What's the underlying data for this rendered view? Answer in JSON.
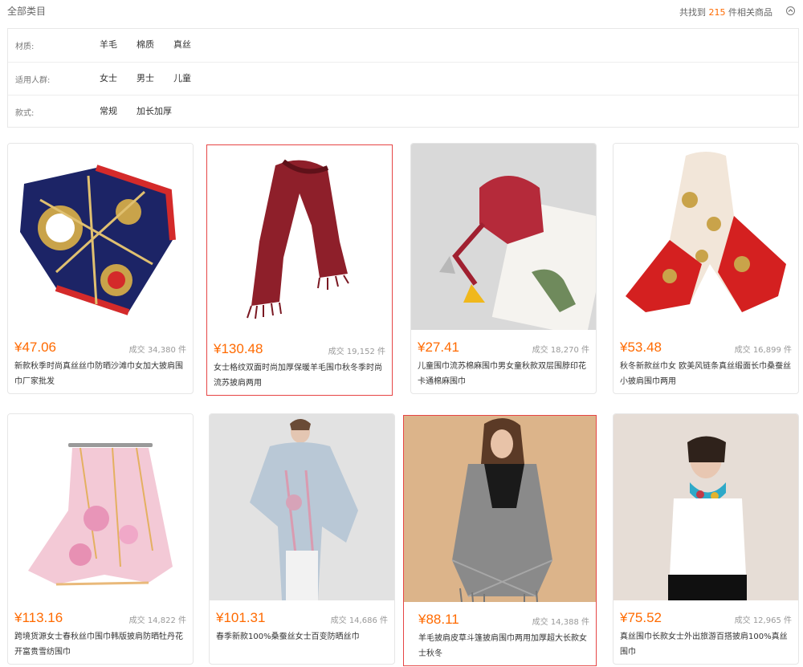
{
  "header": {
    "all_categories": "全部类目",
    "found_prefix": "共找到",
    "found_count": "215",
    "found_suffix": "件相关商品"
  },
  "filters": [
    {
      "label": "材质:",
      "options": [
        "羊毛",
        "棉质",
        "真丝"
      ]
    },
    {
      "label": "适用人群:",
      "options": [
        "女士",
        "男士",
        "儿童"
      ]
    },
    {
      "label": "款式:",
      "options": [
        "常规",
        "加长加厚"
      ]
    }
  ],
  "products": [
    {
      "price": "¥47.06",
      "sales": "成交 34,380 件",
      "title": "新款秋季时尚真丝丝巾防晒沙滩巾女加大披肩围巾厂家批发"
    },
    {
      "price": "¥130.48",
      "sales": "成交 19,152 件",
      "title": "女士格纹双面时尚加厚保暖羊毛围巾秋冬季时尚流苏披肩两用"
    },
    {
      "price": "¥27.41",
      "sales": "成交 18,270 件",
      "title": "儿童围巾流苏棉麻围巾男女童秋款双层围脖印花卡通棉麻围巾"
    },
    {
      "price": "¥53.48",
      "sales": "成交 16,899 件",
      "title": "秋冬新款丝巾女 欧美风链条真丝缎面长巾桑蚕丝小披肩围巾两用"
    },
    {
      "price": "¥113.16",
      "sales": "成交 14,822 件",
      "title": "跨境货源女士春秋丝巾围巾韩版披肩防晒牡丹花开富贵雪纺围巾"
    },
    {
      "price": "¥101.31",
      "sales": "成交 14,686 件",
      "title": "春季新款100%桑蚕丝女士百变防晒丝巾"
    },
    {
      "price": "¥88.11",
      "sales": "成交 14,388 件",
      "title": "羊毛披肩皮草斗篷披肩围巾两用加厚超大长款女士秋冬"
    },
    {
      "price": "¥75.52",
      "sales": "成交 12,965 件",
      "title": "真丝围巾长款女士外出旅游百搭披肩100%真丝围巾"
    }
  ],
  "colors": {
    "price": "#ff6a00",
    "selected_border": "#e64545"
  },
  "icons": [
    "collapse-up-icon"
  ]
}
